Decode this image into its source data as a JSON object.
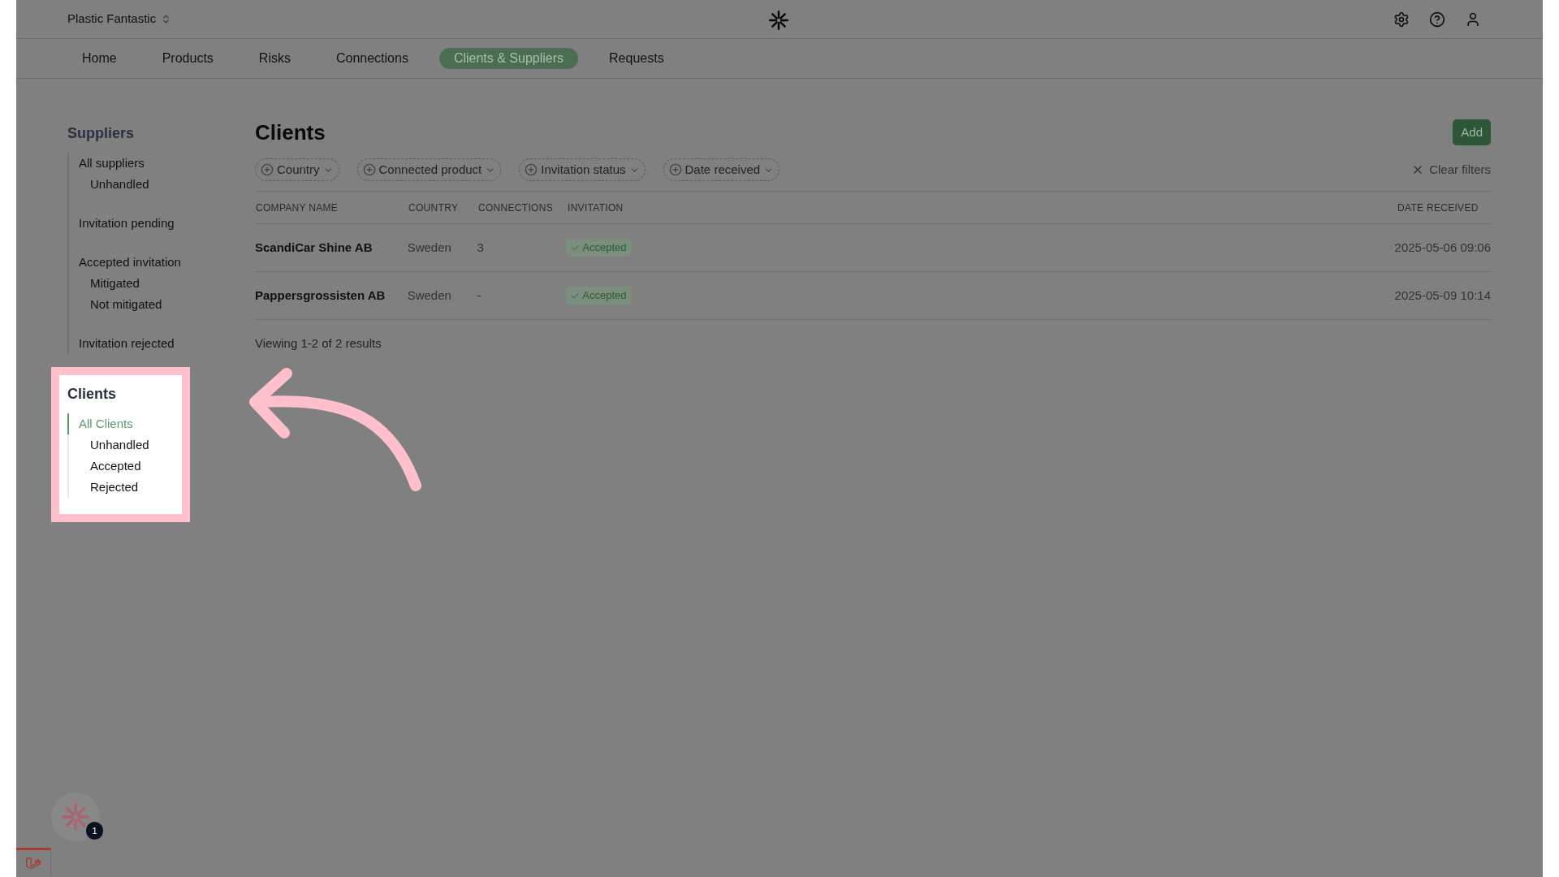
{
  "header": {
    "workspace": "Plastic Fantastic"
  },
  "nav": [
    {
      "label": "Home",
      "selected": false
    },
    {
      "label": "Products",
      "selected": false
    },
    {
      "label": "Risks",
      "selected": false
    },
    {
      "label": "Connections",
      "selected": false
    },
    {
      "label": "Clients & Suppliers",
      "selected": true
    },
    {
      "label": "Requests",
      "selected": false
    }
  ],
  "sidebar": [
    {
      "title": "Suppliers",
      "highlighted": false,
      "items": [
        {
          "label": "All suppliers",
          "selected": false,
          "children": [
            {
              "label": "Unhandled",
              "selected": false
            }
          ]
        },
        {
          "label": "Invitation pending",
          "selected": false
        },
        {
          "label": "Accepted invitation",
          "selected": false,
          "children": [
            {
              "label": "Mitigated",
              "selected": false
            },
            {
              "label": "Not mitigated",
              "selected": false
            }
          ]
        },
        {
          "label": "Invitation rejected",
          "selected": false
        }
      ]
    },
    {
      "title": "Clients",
      "highlighted": true,
      "items": [
        {
          "label": "All Clients",
          "selected": true,
          "children": [
            {
              "label": "Unhandled",
              "selected": false
            },
            {
              "label": "Accepted",
              "selected": false
            },
            {
              "label": "Rejected",
              "selected": false
            }
          ]
        }
      ]
    }
  ],
  "page": {
    "title": "Clients",
    "add_button": "Add",
    "filters": [
      "Country",
      "Connected product",
      "Invitation status",
      "Date received"
    ],
    "clear_filters": "Clear filters"
  },
  "table": {
    "columns": [
      "COMPANY NAME",
      "COUNTRY",
      "CONNECTIONS",
      "INVITATION",
      "DATE RECEIVED"
    ],
    "rows": [
      {
        "company": "ScandiCar Shine AB",
        "country": "Sweden",
        "connections": "3",
        "invitation": "Accepted",
        "date": "2025-05-06 09:06"
      },
      {
        "company": "Pappersgrossisten AB",
        "country": "Sweden",
        "connections": "-",
        "invitation": "Accepted",
        "date": "2025-05-09 10:14"
      }
    ]
  },
  "footer": {
    "results": "Viewing 1-2 of 2 results"
  },
  "assistant": {
    "badge": "1"
  }
}
